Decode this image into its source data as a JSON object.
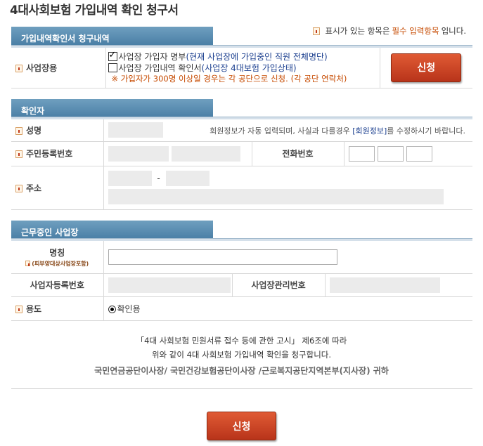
{
  "page": {
    "title": "4대사회보험 가입내역 확인 청구서"
  },
  "legend": {
    "prefix": "표시가 있는 항목은",
    "required": "필수 입력항목",
    "suffix": "입니다."
  },
  "section1": {
    "tab": "가입내역확인서 청구내역",
    "row_label": "사업장용",
    "option1_label": "사업장 가입자 명부",
    "option1_paren": "(현재 사업장에 가입중인 직원 전체명단)",
    "option1_checked": true,
    "option2_label": "사업장 가입내역 확인서",
    "option2_paren": "(사업장 4대보험 가입상태)",
    "option2_checked": false,
    "note": "※ 가입자가 300명 이상일 경우는 각 공단으로 신청.",
    "note_link": "(각 공단 연락처)",
    "apply_button": "신청"
  },
  "section2": {
    "tab": "확인자",
    "name_label": "성명",
    "name_note_pre": "회원정보가 자동 입력되며, 사실과 다를경우 ",
    "name_note_link": "[회원정보]",
    "name_note_post": "를 수정하시기 바랍니다.",
    "rrn_label": "주민등록번호",
    "phone_label": "전화번호",
    "address_label": "주소",
    "zip_separator": "-"
  },
  "section3": {
    "tab": "근무중인 사업장",
    "name_label": "명칭",
    "name_sublabel": "(피부양대상사업장포함)",
    "bizno_label": "사업자등록번호",
    "mgmtno_label": "사업장관리번호",
    "purpose_label": "용도",
    "purpose_option": "확인용"
  },
  "footer": {
    "line1": "「4대 사회보험 민원서류 접수 등에 관한 고시」 제6조에 따라",
    "line2": "위와 같이 4대 사회보험 가입내역 확인을 청구합니다.",
    "signature": "국민연금공단이사장/ 국민건강보험공단이사장 /근로복지공단지역본부(지사장) 귀하",
    "apply_button": "신청"
  }
}
